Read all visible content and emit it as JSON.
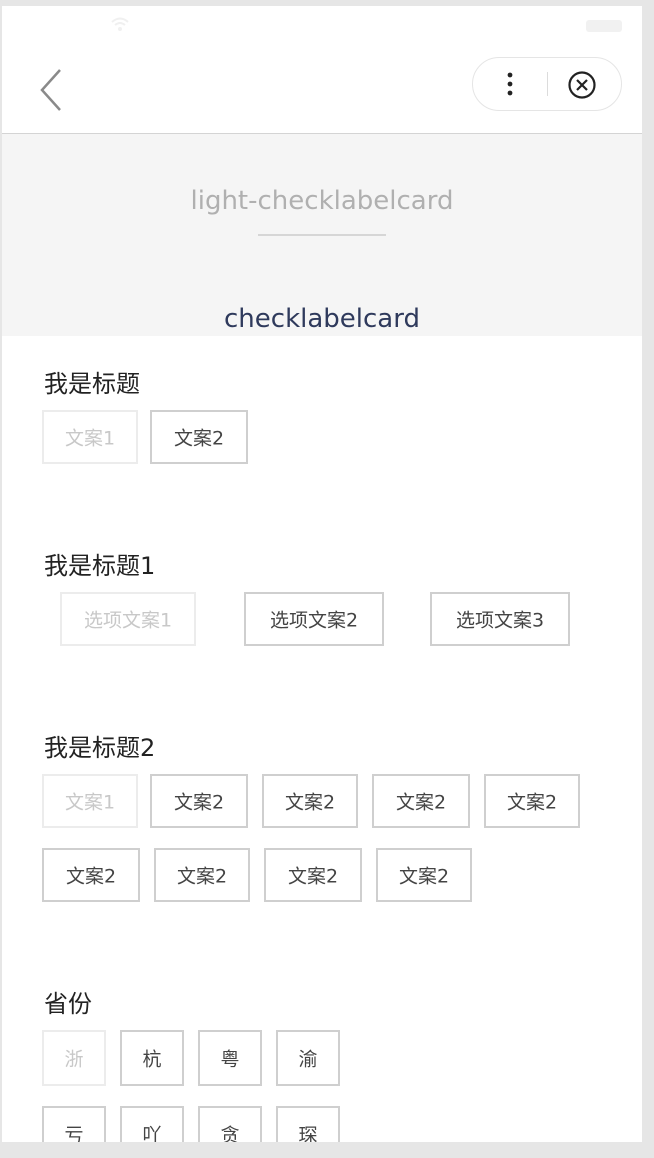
{
  "demo": {
    "title": "light-checklabelcard",
    "subtitle": "checklabelcard"
  },
  "groups": [
    {
      "title": "我是标题",
      "items": [
        "文案1",
        "文案2"
      ]
    },
    {
      "title": "我是标题1",
      "items": [
        "选项文案1",
        "选项文案2",
        "选项文案3"
      ]
    },
    {
      "title": "我是标题2",
      "items": [
        "文案1",
        "文案2",
        "文案2",
        "文案2",
        "文案2",
        "文案2",
        "文案2",
        "文案2",
        "文案2"
      ]
    },
    {
      "title": "省份",
      "items": [
        "浙",
        "杭",
        "粤",
        "渝",
        "亏",
        "吖",
        "贪",
        "琛"
      ]
    }
  ],
  "checked": [
    "group0-item0",
    "group1-item0",
    "group2-item0",
    "group3-item0"
  ],
  "colors": {
    "border": "#cfcfcf",
    "checked_text": "#c8c8c8",
    "subtitle": "#2f3a5c"
  },
  "icons": [
    "wifi-icon",
    "battery-icon",
    "back-arrow-icon",
    "more-dots-icon",
    "close-circle-icon"
  ]
}
